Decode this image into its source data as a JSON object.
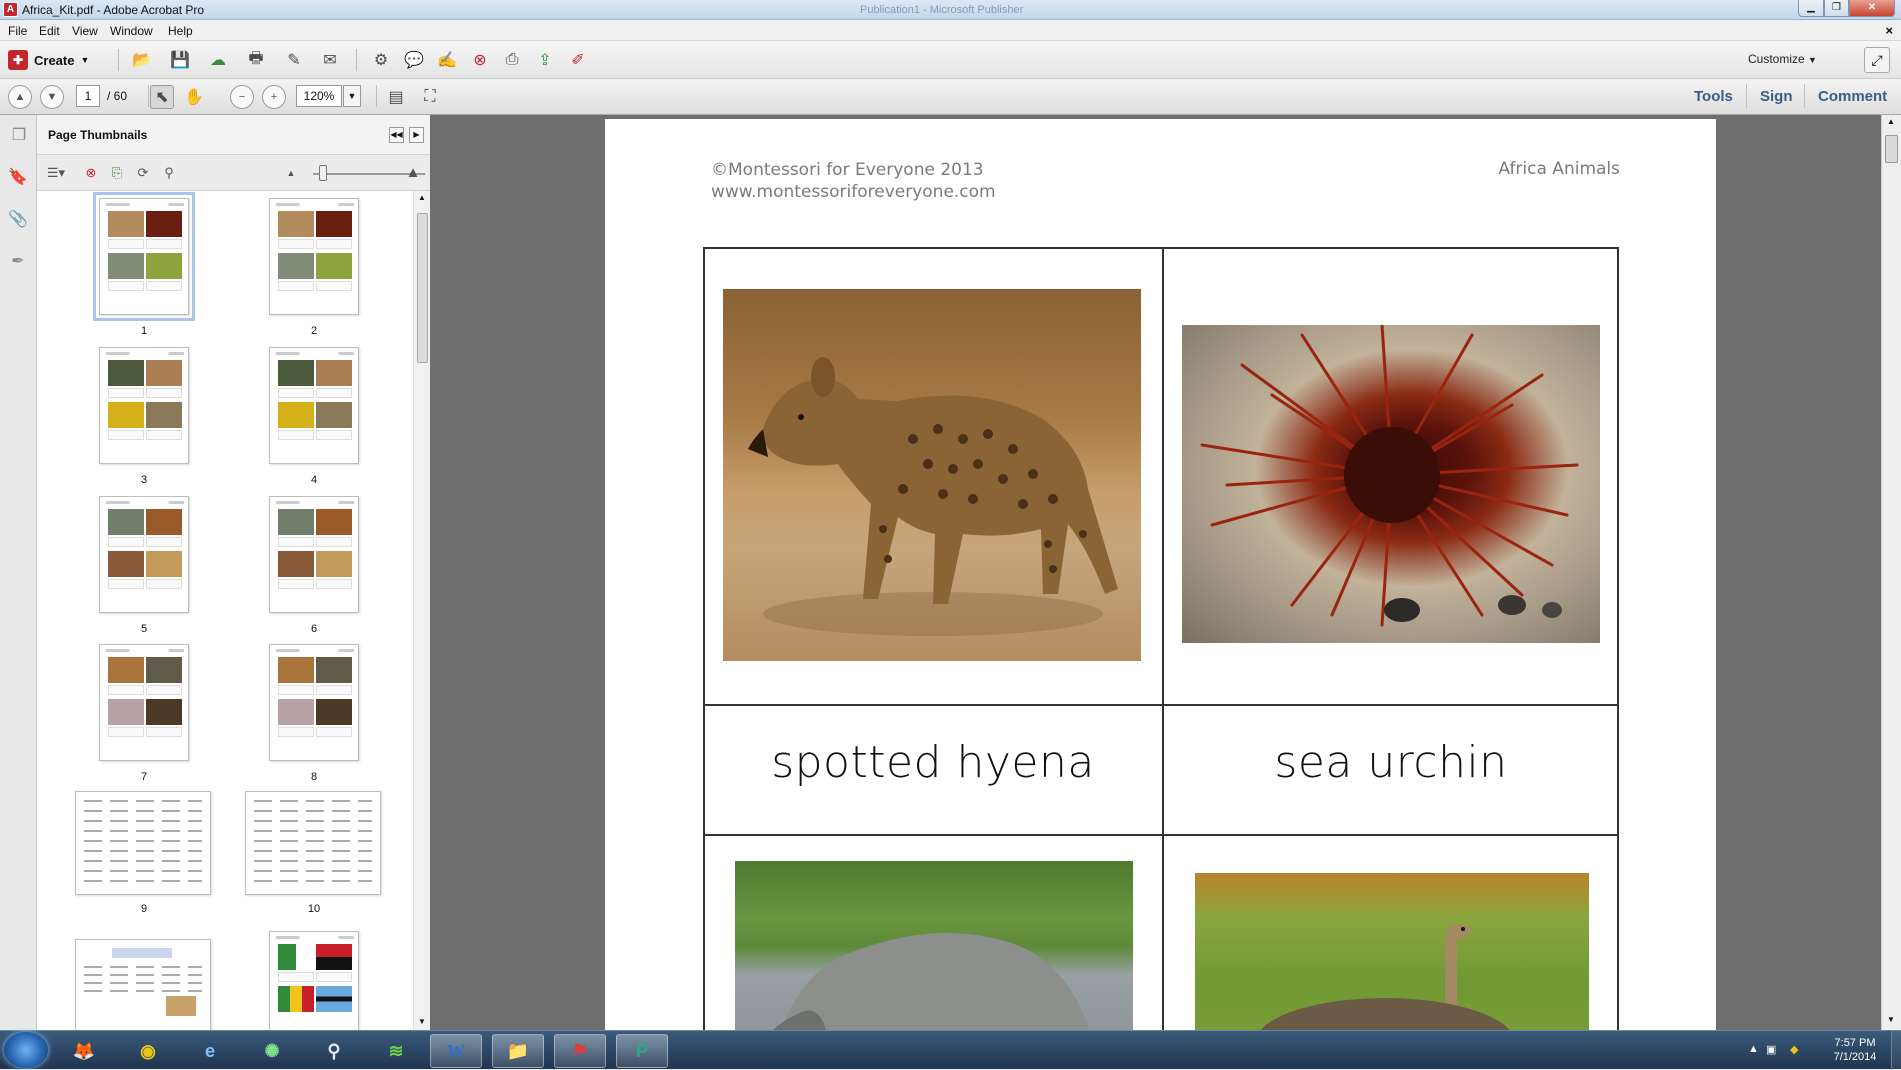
{
  "window": {
    "title": "Africa_Kit.pdf - Adobe Acrobat Pro",
    "background_title": "Publication1 - Microsoft Publisher"
  },
  "menu": {
    "items": [
      "File",
      "Edit",
      "View",
      "Window",
      "Help"
    ]
  },
  "toolbar": {
    "create_label": "Create",
    "customize_label": "Customize"
  },
  "navigation": {
    "current_page": "1",
    "page_total": "/ 60",
    "zoom": "120%"
  },
  "right_tabs": {
    "tools": "Tools",
    "sign": "Sign",
    "comment": "Comment"
  },
  "panel": {
    "title": "Page Thumbnails"
  },
  "thumbnails": [
    {
      "label": "1"
    },
    {
      "label": "2"
    },
    {
      "label": "3"
    },
    {
      "label": "4"
    },
    {
      "label": "5"
    },
    {
      "label": "6"
    },
    {
      "label": "7"
    },
    {
      "label": "8"
    },
    {
      "label": "9"
    },
    {
      "label": "10"
    }
  ],
  "page": {
    "header_left_1": "©Montessori for Everyone 2013",
    "header_left_2": "www.montessoriforeveryone.com",
    "header_right": "Africa  Animals",
    "cards": [
      {
        "label": "spotted hyena"
      },
      {
        "label": "sea urchin"
      }
    ]
  },
  "taskbar": {
    "time": "7:57 PM",
    "date": "7/1/2014",
    "apps": [
      "firefox-icon",
      "chrome-icon",
      "ie-icon",
      "network-icon",
      "search-icon",
      "spotify-icon",
      "word-icon",
      "explorer-icon",
      "acrobat-icon",
      "publisher-icon"
    ]
  },
  "colors": {
    "accent_link": "#3c5d86",
    "acrobat_red": "#c2272d",
    "doc_bg": "#6e6e6e"
  }
}
